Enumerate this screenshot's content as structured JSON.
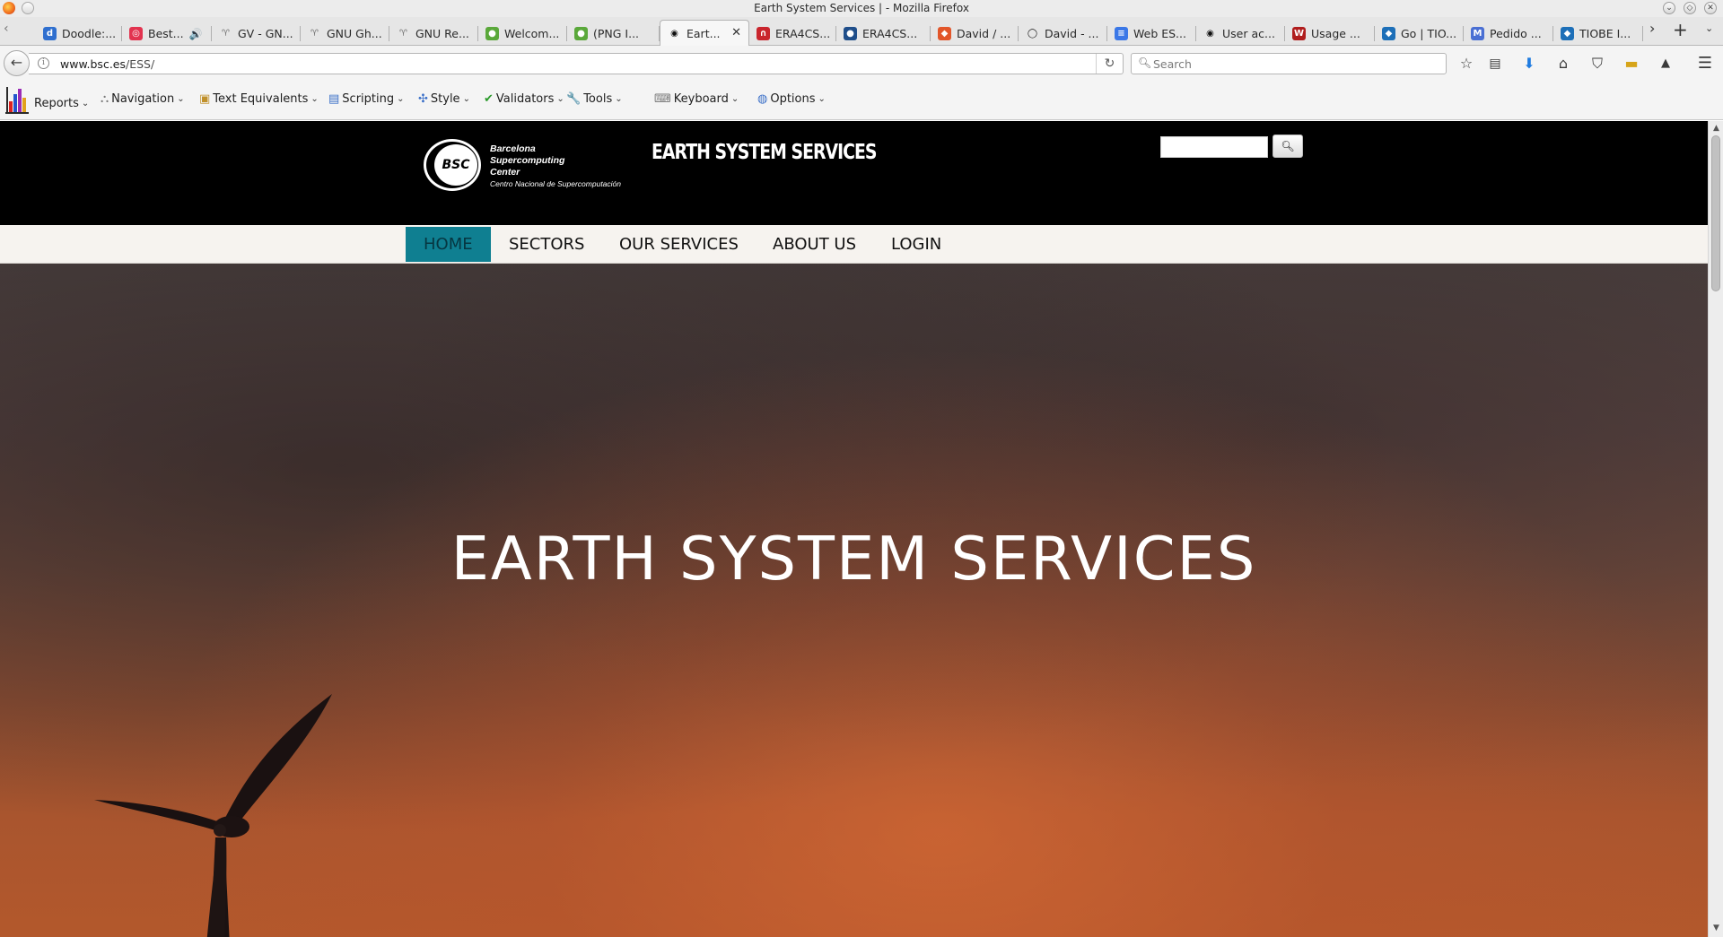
{
  "window": {
    "title": "Earth System Services | - Mozilla Firefox"
  },
  "tabs": [
    {
      "label": "Doodle:...",
      "icon": "doodle-icon",
      "color": "#2f6fcf",
      "glyph": "d"
    },
    {
      "label": "Best...",
      "icon": "pocket-icon",
      "color": "#e2334f",
      "glyph": "◎",
      "audio": "🔊"
    },
    {
      "label": "GV - GN...",
      "icon": "gnu-icon",
      "color": "#6e6e6e",
      "glyph": "♈"
    },
    {
      "label": "GNU Gh...",
      "icon": "gnu-icon",
      "color": "#6e6e6e",
      "glyph": "♈"
    },
    {
      "label": "GNU Re...",
      "icon": "gnu-icon",
      "color": "#6e6e6e",
      "glyph": "♈"
    },
    {
      "label": "Welcom...",
      "icon": "green-circle-icon",
      "color": "#5aa83a",
      "glyph": "●"
    },
    {
      "label": "(PNG I...",
      "icon": "green-circle-icon",
      "color": "#5aa83a",
      "glyph": "●"
    },
    {
      "label": "Eart...",
      "icon": "bsc-icon",
      "color": "#111111",
      "glyph": "◉",
      "active": true
    },
    {
      "label": "ERA4CS...",
      "icon": "era4cs-icon",
      "color": "#c9252d",
      "glyph": "∩"
    },
    {
      "label": "ERA4CS...",
      "icon": "globe-icon",
      "color": "#1f4e8a",
      "glyph": "●"
    },
    {
      "label": "David / ...",
      "icon": "gitlab-icon",
      "color": "#e2562a",
      "glyph": "◆"
    },
    {
      "label": "David - ...",
      "icon": "github-icon",
      "color": "#111111",
      "glyph": "◯"
    },
    {
      "label": "Web ES...",
      "icon": "docs-icon",
      "color": "#3b78e7",
      "glyph": "≡"
    },
    {
      "label": "User ac...",
      "icon": "bsc-icon",
      "color": "#111111",
      "glyph": "◉"
    },
    {
      "label": "Usage ...",
      "icon": "wordreference-icon",
      "color": "#b01d1d",
      "glyph": "W"
    },
    {
      "label": "Go | TIO...",
      "icon": "tiobe-icon",
      "color": "#1d6fb8",
      "glyph": "◆"
    },
    {
      "label": "Pedido ...",
      "icon": "gmail-icon",
      "color": "#4a6fd3",
      "glyph": "M"
    },
    {
      "label": "TIOBE I...",
      "icon": "tiobe-icon",
      "color": "#1d6fb8",
      "glyph": "◆"
    }
  ],
  "navbar": {
    "url_host": "www.bsc.es",
    "url_path": "/ESS/",
    "search_placeholder": "Search"
  },
  "addon_toolbar": [
    {
      "label": "Reports",
      "icon": "reports-icon"
    },
    {
      "label": "Navigation",
      "icon": "navigation-icon",
      "glyph": "⛬"
    },
    {
      "label": "Text Equivalents",
      "icon": "image-icon",
      "glyph": "▣"
    },
    {
      "label": "Scripting",
      "icon": "scripting-icon",
      "glyph": "▤"
    },
    {
      "label": "Style",
      "icon": "style-icon",
      "glyph": "✣"
    },
    {
      "label": "Validators",
      "icon": "checkmark-icon",
      "glyph": "✔"
    },
    {
      "label": "Tools",
      "icon": "wrench-icon",
      "glyph": "🔧"
    },
    {
      "label": "Keyboard",
      "icon": "keyboard-icon",
      "glyph": "⌨"
    },
    {
      "label": "Options",
      "icon": "options-icon",
      "glyph": "◍"
    }
  ],
  "site": {
    "logo_mark": "BSC",
    "logo_line1": "Barcelona",
    "logo_line2": "Supercomputing",
    "logo_line3": "Center",
    "logo_sub": "Centro Nacional de Supercomputación",
    "header_title": "EARTH SYSTEM SERVICES",
    "nav": [
      "HOME",
      "SECTORS",
      "OUR SERVICES",
      "ABOUT US",
      "LOGIN"
    ],
    "active_nav": "HOME",
    "hero_title": "EARTH SYSTEM SERVICES"
  },
  "colors": {
    "site_header_bg": "#000000",
    "nav_active_bg": "#0f7f91",
    "nav_bg": "#f6f3ef"
  }
}
